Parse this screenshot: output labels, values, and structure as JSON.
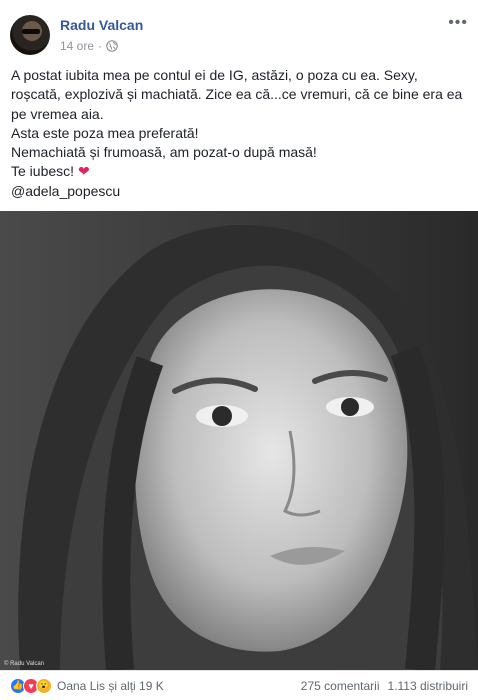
{
  "post": {
    "author": "Radu Valcan",
    "time": "14 ore",
    "menu_icon": "more-icon",
    "text_lines": [
      "A postat iubita mea pe contul ei de IG, astăzi, o poza cu ea. Sexy, roșcată, explozivă și machiată. Zice ea că...ce vremuri, că ce bine era ea pe vremea aia.",
      "Asta este poza mea preferată!",
      "Nemachiată și frumoasă, am pozat-o după masă!",
      "Te iubesc!",
      "@adela_popescu"
    ],
    "heart": "❤",
    "photo_credit": "© Radu Valcan"
  },
  "footer": {
    "reaction_icons": [
      "like-icon",
      "love-icon",
      "wow-icon"
    ],
    "reacted_by": "Oana Lis și alți 19 K",
    "comments": "275 comentarii",
    "shares": "1.113 distribuiri"
  },
  "colors": {
    "author": "#365899",
    "meta": "#90949c",
    "like": "#2078f4",
    "love": "#f33e58",
    "wow": "#f7b125"
  }
}
